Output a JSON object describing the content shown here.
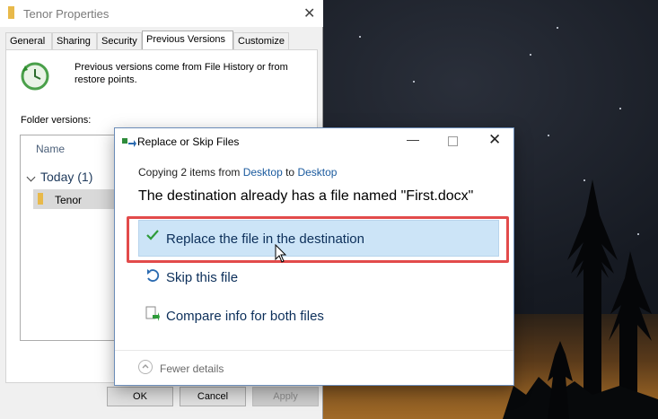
{
  "properties_window": {
    "title": "Tenor Properties",
    "close_glyph": "✕",
    "tabs": [
      {
        "label": "General"
      },
      {
        "label": "Sharing"
      },
      {
        "label": "Security"
      },
      {
        "label": "Previous Versions",
        "active": true
      },
      {
        "label": "Customize"
      }
    ],
    "description": "Previous versions come from File History or from restore points.",
    "folder_versions_label": "Folder versions:",
    "list": {
      "column_name": "Name",
      "group": "Today (1)",
      "row": "Tenor"
    },
    "buttons": {
      "ok": "OK",
      "cancel": "Cancel",
      "apply": "Apply"
    }
  },
  "dialog": {
    "title": "Replace or Skip Files",
    "min_glyph": "—",
    "close_glyph": "✕",
    "copying_prefix": "Copying 2 items from ",
    "copying_source": "Desktop",
    "copying_mid": " to ",
    "copying_dest": "Desktop",
    "message": "The destination already has a file named \"First.docx\"",
    "options": {
      "replace": "Replace the file in the destination",
      "skip": "Skip this file",
      "compare": "Compare info for both files"
    },
    "fewer_details": "Fewer details"
  },
  "icons": {
    "props_folder": "folder-icon",
    "history": "history-clock-icon",
    "check": "checkmark-icon",
    "skip": "skip-arrow-icon",
    "compare": "compare-icon",
    "fewer": "chevron-up-circle-icon",
    "cursor": "mouse-pointer-icon"
  },
  "colors": {
    "link": "#1a5a9e",
    "highlight_border": "#e24b4b",
    "selected_option_bg": "#cce4f7",
    "check_green": "#2e9b3a"
  }
}
